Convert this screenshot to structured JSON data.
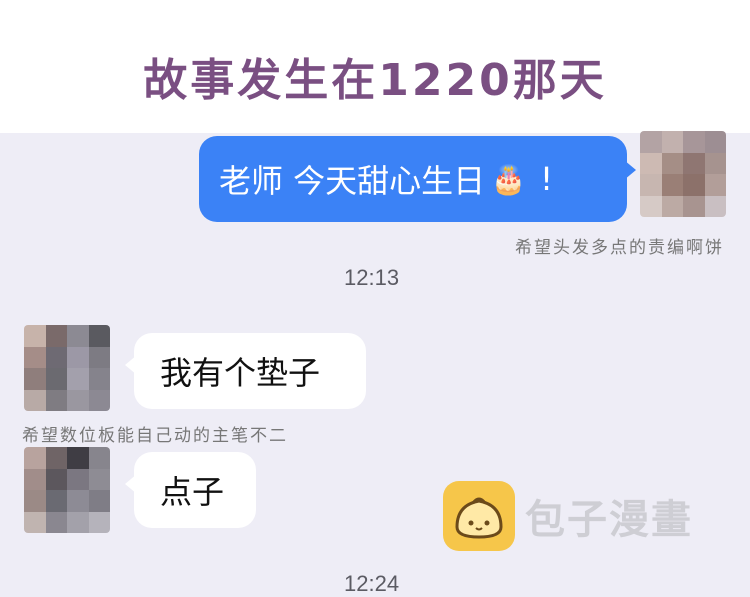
{
  "header": {
    "title": "故事发生在1220那天"
  },
  "messages": {
    "outgoing": {
      "text": "老师 今天甜心生日",
      "emoji": "🎂",
      "tail_text": "!"
    },
    "incoming1": {
      "text": "我有个垫子"
    },
    "incoming2": {
      "text": "点子"
    }
  },
  "captions": {
    "caption1": "希望头发多点的责编啊饼",
    "caption2": "希望数位板能自己动的主笔不二"
  },
  "timestamps": {
    "time1": "12:13",
    "time2": "12:24"
  },
  "watermark": {
    "text": "包子漫畫",
    "icon": "bun-logo-icon"
  },
  "avatars": {
    "right": [
      "#b3a3a4",
      "#c2b1ae",
      "#a79699",
      "#9d8e93",
      "#cdbab3",
      "#a58e86",
      "#8f7672",
      "#a6938f",
      "#c7b6b0",
      "#9a7f76",
      "#8c716a",
      "#b29e99",
      "#d6cac6",
      "#bcaaa4",
      "#a89490",
      "#c9bfc2"
    ],
    "left1": [
      "#c7b3aa",
      "#7a6a6a",
      "#8c8a93",
      "#5a5a60",
      "#a58d88",
      "#6e6a73",
      "#9c98a6",
      "#7d7b83",
      "#8f7e7c",
      "#6b6a70",
      "#a3a0ac",
      "#85838c",
      "#b8aaa6",
      "#7f7c82",
      "#9a97a0",
      "#8c8993"
    ],
    "left2": [
      "#b8a39e",
      "#6f6466",
      "#3f3d44",
      "#87858d",
      "#a18d8a",
      "#5c575d",
      "#7b7781",
      "#8e8c94",
      "#9b8a86",
      "#6a6a72",
      "#8d8b95",
      "#7f7d86",
      "#c0b4b0",
      "#8a8790",
      "#a3a1aa",
      "#b5b3bb"
    ]
  }
}
